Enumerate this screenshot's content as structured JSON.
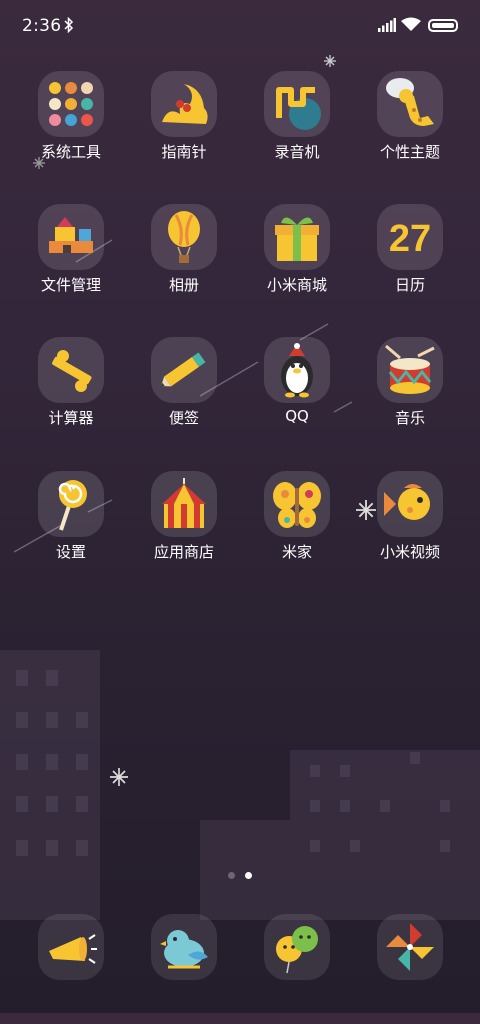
{
  "status_bar": {
    "time": "2:36",
    "icons": [
      "bluetooth-icon",
      "signal-icon",
      "wifi-icon",
      "battery-icon"
    ]
  },
  "apps": [
    {
      "label": "系统工具",
      "icon": "system-tools-folder-icon"
    },
    {
      "label": "指南针",
      "icon": "compass-icon"
    },
    {
      "label": "录音机",
      "icon": "recorder-icon"
    },
    {
      "label": "个性主题",
      "icon": "themes-giraffe-icon"
    },
    {
      "label": "文件管理",
      "icon": "file-manager-blocks-icon"
    },
    {
      "label": "相册",
      "icon": "gallery-balloon-icon"
    },
    {
      "label": "小米商城",
      "icon": "mi-store-gift-icon"
    },
    {
      "label": "日历",
      "icon": "calendar-icon"
    },
    {
      "label": "计算器",
      "icon": "calculator-icon"
    },
    {
      "label": "便签",
      "icon": "notes-pencil-icon"
    },
    {
      "label": "QQ",
      "icon": "qq-penguin-icon"
    },
    {
      "label": "音乐",
      "icon": "music-drum-icon"
    },
    {
      "label": "设置",
      "icon": "settings-lollipop-icon"
    },
    {
      "label": "应用商店",
      "icon": "app-store-tent-icon"
    },
    {
      "label": "米家",
      "icon": "mijia-butterfly-icon"
    },
    {
      "label": "小米视频",
      "icon": "mi-video-fish-icon"
    }
  ],
  "calendar_day": "27",
  "page_indicator": {
    "count": 2,
    "current": 2
  },
  "dock": [
    {
      "icon": "phone-horn-icon"
    },
    {
      "icon": "messages-bird-icon"
    },
    {
      "icon": "contacts-balloons-icon"
    },
    {
      "icon": "browser-pinwheel-icon"
    }
  ],
  "colors": {
    "tile_bg": "rgba(255,255,255,0.13)",
    "accent_yellow": "#f6c531",
    "wallpaper_top": "#3b2a3e"
  }
}
